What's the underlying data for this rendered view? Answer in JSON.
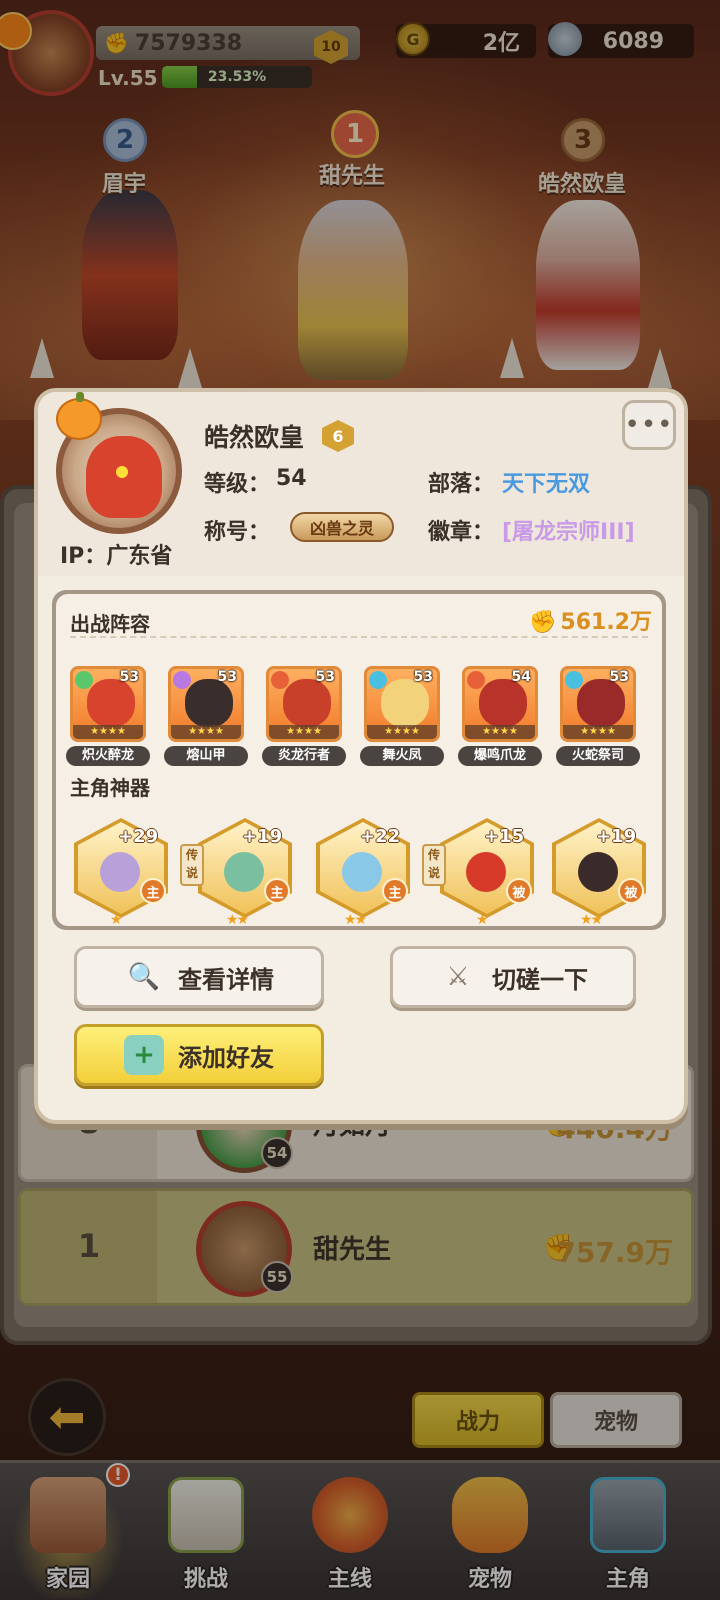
{
  "hud": {
    "power": "7579338",
    "vip_level": "10",
    "level_label": "Lv.55",
    "exp_percent": "23.53%",
    "exp_fraction": 0.2353,
    "gold": "2亿",
    "gems": "6089"
  },
  "podium": [
    {
      "rank": "2",
      "name": "眉宇"
    },
    {
      "rank": "1",
      "name": "甜先生"
    },
    {
      "rank": "3",
      "name": "皓然欧皇"
    }
  ],
  "ranking_rows": [
    {
      "rank": "8",
      "name": "月如月",
      "level": "54",
      "power": "440.4万"
    },
    {
      "rank": "1",
      "name": "甜先生",
      "level": "55",
      "power": "757.9万"
    }
  ],
  "sort_tabs": {
    "power": "战力",
    "pet": "宠物"
  },
  "bottom_nav": [
    {
      "label": "家园",
      "alert": "!"
    },
    {
      "label": "挑战"
    },
    {
      "label": "主线"
    },
    {
      "label": "宠物"
    },
    {
      "label": "主角"
    }
  ],
  "profile": {
    "name": "皓然欧皇",
    "vip": "6",
    "more": "•••",
    "ip_label": "IP：",
    "ip_value": "广东省",
    "level_label": "等级：",
    "level_value": "54",
    "tribe_label": "部落：",
    "tribe_value": "天下无双",
    "title_label": "称号：",
    "title_value": "凶兽之灵",
    "badge_label": "徽章：",
    "badge_value": "[屠龙宗师III]"
  },
  "lineup": {
    "title": "出战阵容",
    "power": "561.2万",
    "pets": [
      {
        "name": "炽火醉龙",
        "level": "53"
      },
      {
        "name": "熔山甲",
        "level": "53"
      },
      {
        "name": "炎龙行者",
        "level": "53"
      },
      {
        "name": "舞火凤",
        "level": "53"
      },
      {
        "name": "爆鸣爪龙",
        "level": "54"
      },
      {
        "name": "火蛇祭司",
        "level": "53"
      }
    ],
    "artifact_title": "主角神器",
    "artifacts": [
      {
        "level": "+29",
        "tag": "主",
        "legend": "",
        "stars": "★"
      },
      {
        "level": "+19",
        "tag": "主",
        "legend": "传说",
        "stars": "★★"
      },
      {
        "level": "+22",
        "tag": "主",
        "legend": "",
        "stars": "★★"
      },
      {
        "level": "+15",
        "tag": "被",
        "legend": "传说",
        "stars": "★"
      },
      {
        "level": "+19",
        "tag": "被",
        "legend": "",
        "stars": "★★"
      }
    ]
  },
  "actions": {
    "details": "查看详情",
    "spar": "切磋一下",
    "add_friend": "添加好友"
  },
  "colors": {
    "tribe": "#4a9ae0",
    "badge": "#c89ae8",
    "accent_gold": "#d99020"
  }
}
